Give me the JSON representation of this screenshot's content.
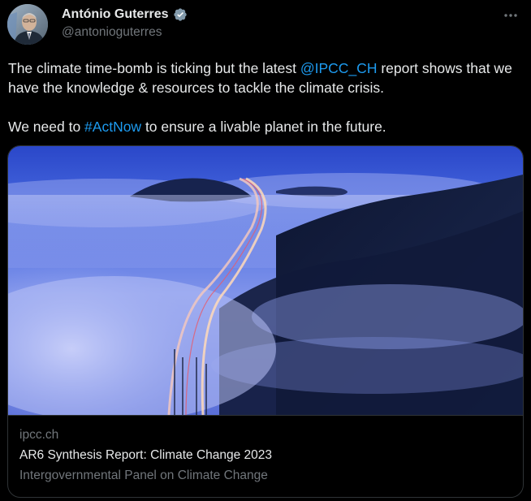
{
  "author": {
    "name": "António Guterres",
    "handle": "@antonioguterres",
    "verified": true
  },
  "tweet": {
    "line1_prefix": "The climate time-bomb is ticking but the latest ",
    "line1_mention": "@IPCC_CH",
    "line1_suffix": " report shows that we have the knowledge & resources to tackle the climate crisis.",
    "line2_prefix": "We need to ",
    "line2_hashtag": "#ActNow",
    "line2_suffix": " to ensure a livable planet in the future."
  },
  "card": {
    "domain": "ipcc.ch",
    "title": "AR6 Synthesis Report: Climate Change 2023",
    "description": "Intergovernmental Panel on Climate Change"
  },
  "icons": {
    "verified": "verified-badge-icon",
    "more": "more-options-icon"
  },
  "colors": {
    "background": "#000000",
    "text": "#e7e9ea",
    "secondary": "#71767b",
    "link": "#1d9bf0",
    "border": "#2f3336"
  }
}
